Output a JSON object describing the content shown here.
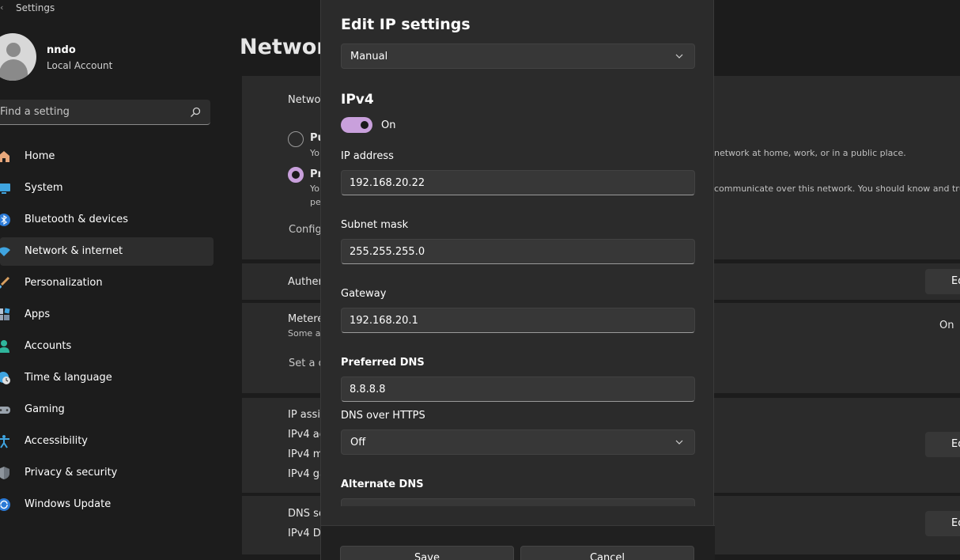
{
  "window": {
    "title": "Settings"
  },
  "profile": {
    "name": "nndo",
    "account_type": "Local Account"
  },
  "search": {
    "placeholder": "Find a setting"
  },
  "nav": {
    "items": [
      {
        "label": "Home",
        "icon": "home-icon"
      },
      {
        "label": "System",
        "icon": "system-icon"
      },
      {
        "label": "Bluetooth & devices",
        "icon": "bluetooth-icon"
      },
      {
        "label": "Network & internet",
        "icon": "wifi-icon",
        "active": true
      },
      {
        "label": "Personalization",
        "icon": "brush-icon"
      },
      {
        "label": "Apps",
        "icon": "apps-icon"
      },
      {
        "label": "Accounts",
        "icon": "person-icon"
      },
      {
        "label": "Time & language",
        "icon": "globe-clock-icon"
      },
      {
        "label": "Gaming",
        "icon": "gamepad-icon"
      },
      {
        "label": "Accessibility",
        "icon": "accessibility-icon"
      },
      {
        "label": "Privacy & security",
        "icon": "shield-icon"
      },
      {
        "label": "Windows Update",
        "icon": "update-icon"
      }
    ]
  },
  "page": {
    "title": "Network",
    "profile_type_label": "Netwo",
    "public_option": "Pu",
    "public_desc": "Yo",
    "public_desc_rest": "network at home, work, or in a public place.",
    "private_option": "Pr",
    "private_desc": "Yo",
    "private_desc_line2": "pe",
    "private_desc_rest": "communicate over this network. You should know and tru",
    "configure_link": "Config",
    "auth_label": "Auther",
    "auth_edit": "Ed",
    "metered_label": "Metere",
    "metered_sub": "Some a",
    "metered_value": "On",
    "data_limit_link": "Set a d",
    "ip_assignment": "IP assig",
    "ipv4_address": "IPv4 ac",
    "ipv4_mask": "IPv4 m",
    "ipv4_gateway": "IPv4 ga",
    "ip_edit": "Ed",
    "dns_server": "DNS se",
    "ipv4_dns": "IPv4 DI",
    "dns_edit": "Ed"
  },
  "dialog": {
    "title": "Edit IP settings",
    "mode": "Manual",
    "section": "IPv4",
    "ipv4_toggle": {
      "state": "On",
      "on": true
    },
    "ip_address": {
      "label": "IP address",
      "value": "192.168.20.22"
    },
    "subnet_mask": {
      "label": "Subnet mask",
      "value": "255.255.255.0"
    },
    "gateway": {
      "label": "Gateway",
      "value": "192.168.20.1"
    },
    "preferred_dns": {
      "label": "Preferred DNS",
      "value": "8.8.8.8"
    },
    "dns_over_https": {
      "label": "DNS over HTTPS",
      "value": "Off"
    },
    "alternate_dns": {
      "label": "Alternate DNS",
      "value": ""
    },
    "save_label": "Save",
    "cancel_label": "Cancel"
  },
  "colors": {
    "accent": "#c9a0dc",
    "background": "#1c1c1c",
    "card": "#2b2b2b",
    "control": "#373737"
  }
}
